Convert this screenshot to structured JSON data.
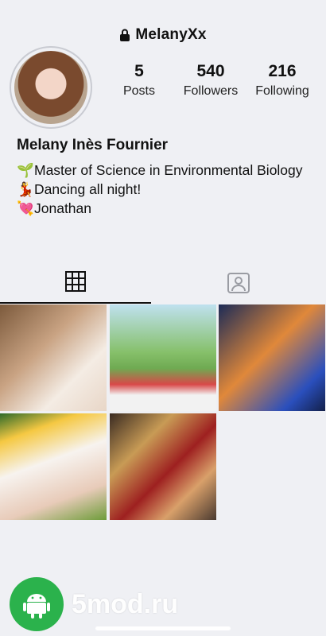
{
  "header": {
    "username": "MelanyXx",
    "lock_icon": "lock-icon"
  },
  "profile": {
    "stats": [
      {
        "value": "5",
        "label": "Posts"
      },
      {
        "value": "540",
        "label": "Followers"
      },
      {
        "value": "216",
        "label": "Following"
      }
    ],
    "name": "Melany Inès Fournier",
    "bio": [
      {
        "emoji": "🌱",
        "text": "Master of Science in Environmental Biology"
      },
      {
        "emoji": "💃",
        "text": "Dancing all night!"
      },
      {
        "emoji": "💘",
        "text": "Jonathan"
      }
    ]
  },
  "tabs": [
    {
      "icon": "grid-icon",
      "active": true
    },
    {
      "icon": "tagged-person-icon",
      "active": false
    }
  ],
  "posts_count_visible": 5,
  "watermark": {
    "text": "5mod.ru",
    "icon": "android-icon",
    "color": "#2bb24c"
  }
}
